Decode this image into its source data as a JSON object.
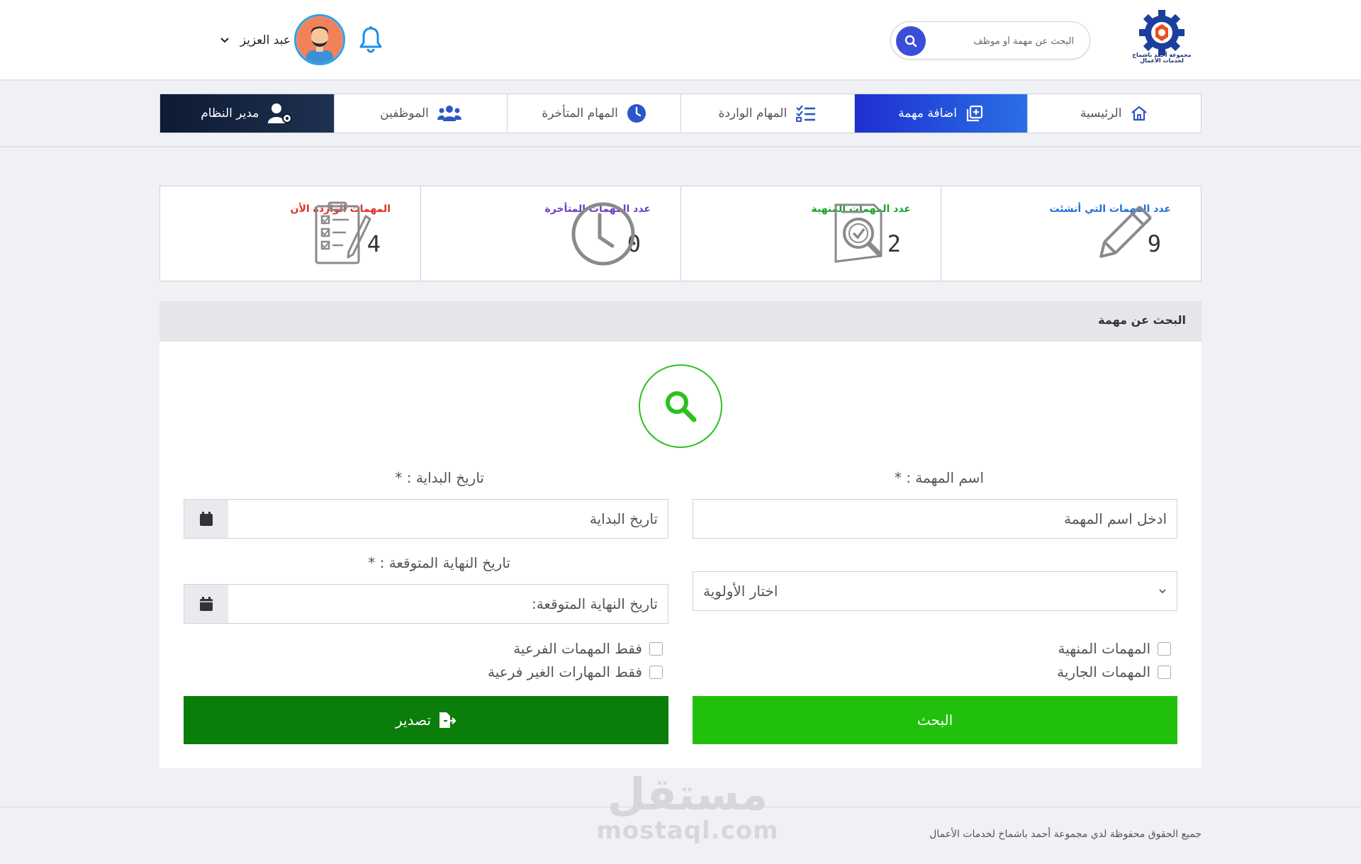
{
  "header": {
    "logo_text": "مجموعة أحمد باشماخ لخدمات الأعمال",
    "search_placeholder": "البحث عن مهمة أو موظف",
    "user_name": "عبد العزيز"
  },
  "nav": {
    "items": [
      {
        "label": "الرئيسية",
        "icon": "home-icon"
      },
      {
        "label": "اضافة مهمة",
        "icon": "add-task-icon",
        "active": true
      },
      {
        "label": "المهام الواردة",
        "icon": "task-list-icon"
      },
      {
        "label": "المهام المتأخرة",
        "icon": "clock-icon"
      },
      {
        "label": "الموظفين",
        "icon": "users-icon"
      },
      {
        "label": "مدير النظام",
        "icon": "user-gear-icon"
      }
    ]
  },
  "stats": [
    {
      "label": "عدد المهمات التي أنشئت",
      "value": "9",
      "color": "#1f6fe0",
      "icon": "pencil-icon"
    },
    {
      "label": "عدد المهمات المنهية",
      "value": "2",
      "color": "#1aa12a",
      "icon": "document-check-icon"
    },
    {
      "label": "عدد المهمات المتأخرة",
      "value": "0",
      "color": "#6a3fc4",
      "icon": "clock-outline-icon"
    },
    {
      "label": "المهمات الواردة الأن",
      "value": "4",
      "color": "#e0302a",
      "icon": "clipboard-checklist-icon"
    }
  ],
  "panel": {
    "title": "البحث عن مهمة",
    "task_name_label": "اسم المهمة : *",
    "task_name_placeholder": "ادخل اسم المهمة",
    "start_date_label": "تاريخ البداية : *",
    "start_date_placeholder": "تاريخ البداية",
    "end_date_label": "تاريخ النهاية المتوقعة : *",
    "end_date_placeholder": "تاريخ النهاية المتوقعة:",
    "priority_placeholder": "اختار الأولوية",
    "checkboxes": {
      "finished": "المهمات المنهية",
      "ongoing": "المهمات الجارية",
      "sub_only": "فقط المهمات الفرعية",
      "non_sub_only": "فقط المهارات الغير فرعية"
    },
    "search_button": "البحث",
    "export_button": "تصدير"
  },
  "footer": {
    "copyright": "جميع الحقوق محفوظة لدي مجموعة أحمد باشماخ لخدمات الأعمال",
    "watermark_ar": "مستقل",
    "watermark_en": "mostaql.com"
  },
  "colors": {
    "primary": "#1d2fd0",
    "admin": "#0d1a33",
    "search_green": "#21c00c",
    "export_green": "#0a7d0b"
  }
}
